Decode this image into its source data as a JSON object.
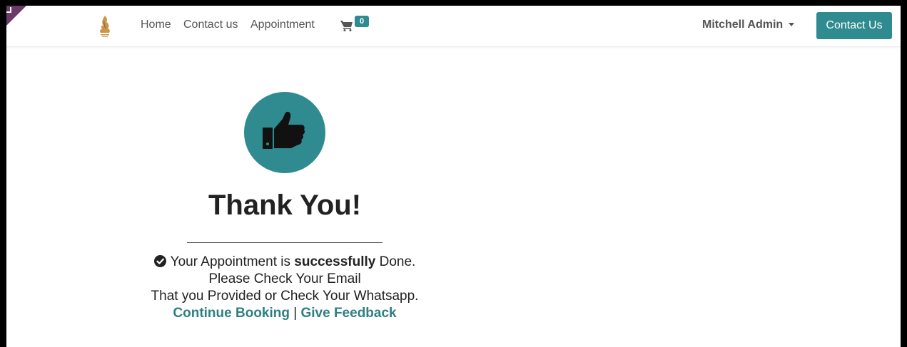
{
  "nav": {
    "home": "Home",
    "contact": "Contact us",
    "appointment": "Appointment",
    "cart_count": "0",
    "user": "Mitchell Admin",
    "contact_button": "Contact Us"
  },
  "confirmation": {
    "title": "Thank You!",
    "line1_prefix": "Your Appointment is ",
    "line1_bold": "successfully",
    "line1_suffix": " Done.",
    "line2": "Please Check Your Email",
    "line3": "That you Provided or Check Your Whatsapp.",
    "continue_link": "Continue Booking",
    "separator": "|",
    "feedback_link": "Give Feedback"
  },
  "icons": {
    "logo": "flame-logo-icon",
    "cart": "shopping-cart-icon",
    "thumb": "thumbs-up-icon",
    "check": "check-circle-icon",
    "caret": "caret-down-icon"
  },
  "colors": {
    "accent": "#2f8b8f",
    "link": "#2f7f82",
    "corner": "#6b3a6b"
  }
}
